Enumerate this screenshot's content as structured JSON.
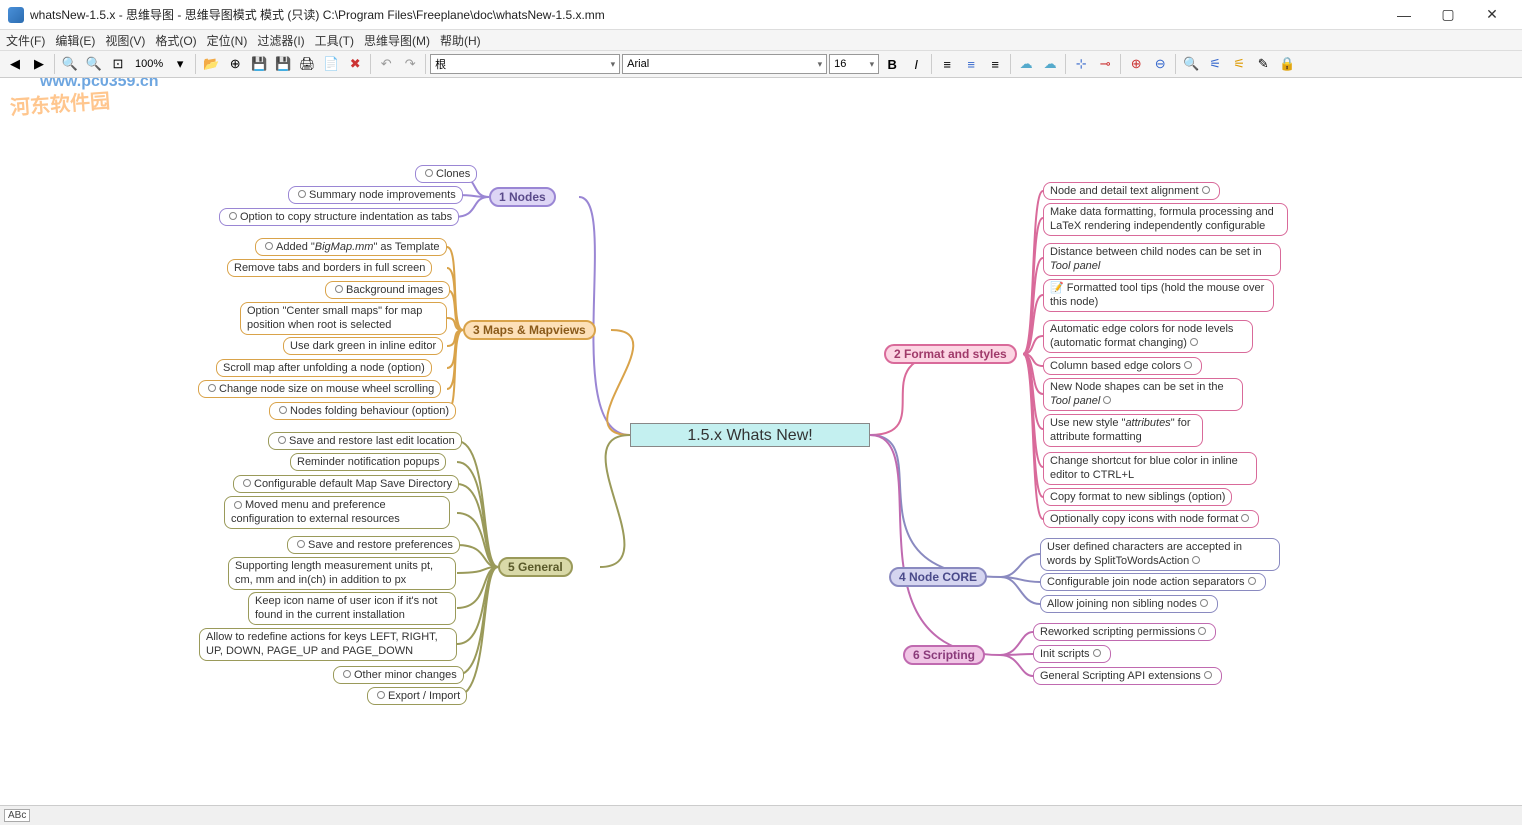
{
  "window": {
    "title": "whatsNew-1.5.x - 思维导图 - 思维导图模式 模式 (只读) C:\\Program Files\\Freeplane\\doc\\whatsNew-1.5.x.mm"
  },
  "menu": {
    "file": "文件(F)",
    "edit": "编辑(E)",
    "view": "视图(V)",
    "format": "格式(O)",
    "nav": "定位(N)",
    "filter": "过滤器(I)",
    "tools": "工具(T)",
    "mindmap": "思维导图(M)",
    "help": "帮助(H)"
  },
  "toolbar": {
    "zoom": "100%",
    "styleCombo": "根",
    "fontCombo": "Arial",
    "sizeCombo": "16"
  },
  "root": {
    "title": "1.5.x Whats New!"
  },
  "left": {
    "nodes": {
      "label": "1 Nodes",
      "children": [
        "Clones",
        "Summary node improvements",
        "Option to copy structure indentation as tabs"
      ]
    },
    "maps": {
      "label": "3 Maps & Mapviews",
      "children": [
        "Added \"BigMap.mm\" as Template",
        "Remove tabs and borders in full screen",
        "Background images",
        "Option \"Center small maps\" for map position when root is selected",
        "Use dark green in inline editor",
        "Scroll map after unfolding a node (option)",
        "Change node size on mouse wheel scrolling",
        "Nodes folding behaviour (option)"
      ]
    },
    "general": {
      "label": "5 General",
      "children": [
        "Save and restore last edit location",
        "Reminder notification popups",
        "Configurable default Map Save Directory",
        "Moved menu and preference configuration to external resources",
        "Save and restore preferences",
        "Supporting length measurement units pt, cm, mm and in(ch) in addition to px",
        "Keep icon name of user icon if it's not found in the current installation",
        "Allow to redefine actions for keys LEFT, RIGHT, UP, DOWN, PAGE_UP and PAGE_DOWN",
        "Other minor changes",
        "Export / Import"
      ]
    }
  },
  "right": {
    "format": {
      "label": "2 Format and styles",
      "children": [
        "Node and detail text alignment",
        "Make data formatting, formula processing and LaTeX rendering independently configurable",
        "Distance between child nodes can be set in Tool panel",
        "📝 Formatted tool tips        (hold the mouse over this node)",
        "Automatic edge colors for node levels (automatic format changing)",
        "Column based edge colors",
        "New Node shapes can be set in the Tool panel",
        "Use new style \"attributes\" for attribute formatting",
        "Change shortcut for blue color in inline editor to CTRL+L",
        "Copy format to new siblings (option)",
        "Optionally copy icons with node format"
      ]
    },
    "core": {
      "label": "4 Node CORE",
      "children": [
        "User defined characters are accepted in words by SplitToWordsAction",
        "Configurable join node action separators",
        "Allow joining non sibling nodes"
      ]
    },
    "scripting": {
      "label": "6 Scripting",
      "children": [
        "Reworked scripting permissions",
        "Init scripts",
        "General Scripting API extensions"
      ]
    }
  },
  "status": {
    "abc": "ABc"
  }
}
